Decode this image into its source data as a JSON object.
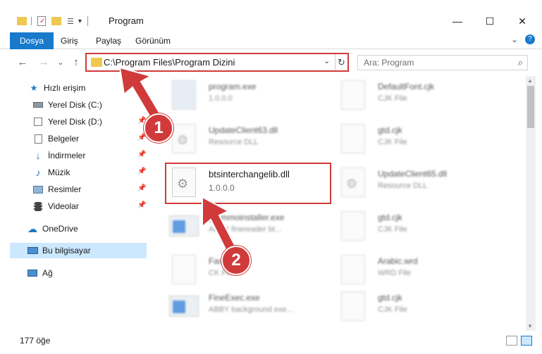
{
  "window": {
    "title": "Program"
  },
  "ribbon": {
    "tabs": [
      "Dosya",
      "Giriş",
      "Paylaş",
      "Görünüm"
    ],
    "expand_glyph": "⌄",
    "help_glyph": "?"
  },
  "window_controls": {
    "minimize": "—",
    "maximize": "☐",
    "close": "✕"
  },
  "nav_buttons": {
    "back": "←",
    "forward": "→",
    "recent": "⌄",
    "up": "↑"
  },
  "address": {
    "path": "C:\\Program Files\\Program Dizini",
    "dropdown": "⌄",
    "refresh": "↻"
  },
  "search": {
    "placeholder": "Ara: Program",
    "icon": "⌕"
  },
  "navpane": {
    "quick_access": "Hızlı erişim",
    "items": [
      {
        "label": "Yerel Disk (C:)",
        "icon": "drive-icon",
        "pinned": false
      },
      {
        "label": "Yerel Disk (D:)",
        "icon": "drive-icon",
        "pinned": true
      },
      {
        "label": "Belgeler",
        "icon": "documents-icon",
        "pinned": true
      },
      {
        "label": "İndirmeler",
        "icon": "downloads-icon",
        "pinned": true
      },
      {
        "label": "Müzik",
        "icon": "music-icon",
        "pinned": true
      },
      {
        "label": "Resimler",
        "icon": "pictures-icon",
        "pinned": true
      },
      {
        "label": "Videolar",
        "icon": "videos-icon",
        "pinned": true
      }
    ],
    "onedrive": "OneDrive",
    "this_pc": "Bu bilgisayar",
    "network": "Ağ",
    "pin_glyph": "📌"
  },
  "files": [
    {
      "name": "program.exe",
      "sub": "1.0.0.0"
    },
    {
      "name": "DefaultFont.cjk",
      "sub": "CJK File"
    },
    {
      "name": "UpdateClient63.dll",
      "sub": "Resource DLL"
    },
    {
      "name": "gtd.cjk",
      "sub": "CJK File"
    },
    {
      "name": "btsinterchangelib.dll",
      "sub": "1.0.0.0"
    },
    {
      "name": "UpdateClient65.dll",
      "sub": "Resource DLL"
    },
    {
      "name": "grammoinstaller.exe",
      "sub": "ABBY finereader bt..."
    },
    {
      "name": "gtd.cjk",
      "sub": "CJK File"
    },
    {
      "name": "FastRead",
      "sub": "CK File"
    },
    {
      "name": "Arabic.wrd",
      "sub": "WRD File"
    },
    {
      "name": "FineExec.exe",
      "sub": "ABBY background exe..."
    },
    {
      "name": "gtd.cjk",
      "sub": "CJK File"
    }
  ],
  "status": {
    "count": "177 öğe"
  },
  "markers": [
    "1",
    "2"
  ],
  "colors": {
    "accent": "#1979ca",
    "highlight": "#d03a3a",
    "selection": "#cce8ff"
  }
}
